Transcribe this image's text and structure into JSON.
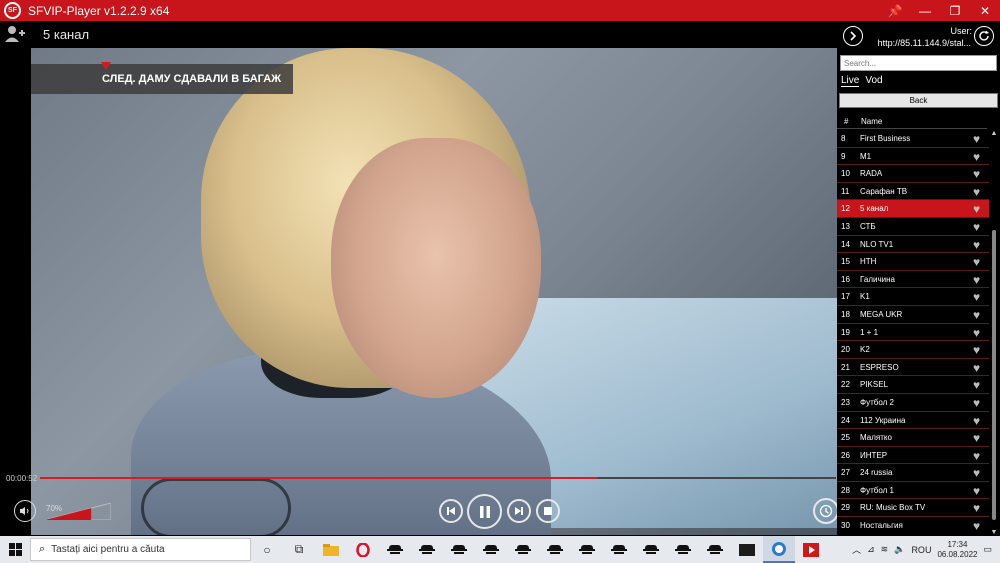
{
  "window": {
    "title": "SFVIP-Player v1.2.2.9 x64",
    "app_icon": "SF",
    "pin_icon": "📌",
    "min_icon": "—",
    "max_icon": "❐",
    "close_icon": "✕"
  },
  "player": {
    "channel_title": "5 канал",
    "caption": "СЛЕД. ДАМУ СДАВАЛИ В БАГАЖ",
    "time": "00:00:52",
    "progress_fraction": 0.7,
    "volume_label": "70%",
    "volume_fraction": 0.7
  },
  "panel": {
    "user_label": "User:",
    "user_url": "http://85.11.144.9/stal...",
    "search_placeholder": "Search...",
    "tabs": [
      {
        "label": "Live",
        "active": true
      },
      {
        "label": "Vod",
        "active": false
      }
    ],
    "back_label": "Back",
    "col_num": "#",
    "col_name": "Name",
    "channels": [
      {
        "num": "8",
        "name": "First Business"
      },
      {
        "num": "9",
        "name": "M1"
      },
      {
        "num": "10",
        "name": "RADA"
      },
      {
        "num": "11",
        "name": "Сарафан ТВ"
      },
      {
        "num": "12",
        "name": "5 канал"
      },
      {
        "num": "13",
        "name": "СТБ"
      },
      {
        "num": "14",
        "name": "NLO TV1"
      },
      {
        "num": "15",
        "name": "НТН"
      },
      {
        "num": "16",
        "name": "Галичина"
      },
      {
        "num": "17",
        "name": "K1"
      },
      {
        "num": "18",
        "name": "MEGA UKR"
      },
      {
        "num": "19",
        "name": "1 + 1"
      },
      {
        "num": "20",
        "name": "K2"
      },
      {
        "num": "21",
        "name": "ESPRESO"
      },
      {
        "num": "22",
        "name": "PIKSEL"
      },
      {
        "num": "23",
        "name": "Футбол 2"
      },
      {
        "num": "24",
        "name": "112 Украина"
      },
      {
        "num": "25",
        "name": "Малятко"
      },
      {
        "num": "26",
        "name": "ИНТЕР"
      },
      {
        "num": "27",
        "name": "24 russia"
      },
      {
        "num": "28",
        "name": "Футбол 1"
      },
      {
        "num": "29",
        "name": "RU: Music Box TV"
      },
      {
        "num": "30",
        "name": "Ностальгия"
      }
    ],
    "selected_num": "12"
  },
  "taskbar": {
    "search_placeholder": "Tastați aici pentru a căuta",
    "language": "ROU",
    "time": "17:34",
    "date": "06.08.2022"
  }
}
